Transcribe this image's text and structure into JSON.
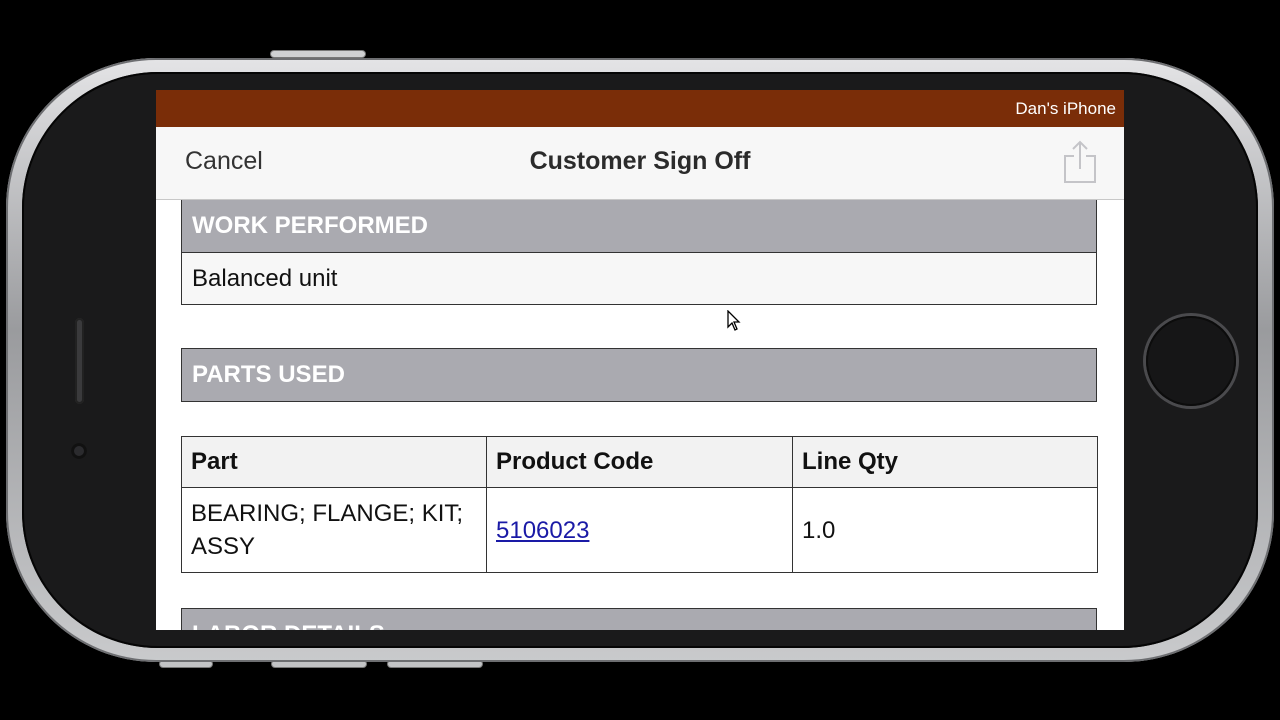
{
  "status_bar": {
    "device_name": "Dan's iPhone"
  },
  "nav": {
    "cancel_label": "Cancel",
    "title": "Customer Sign Off",
    "share_icon": "share-icon"
  },
  "work_performed": {
    "header": "WORK PERFORMED",
    "value": "Balanced unit"
  },
  "parts_used": {
    "header": "PARTS USED",
    "columns": [
      "Part",
      "Product Code",
      "Line Qty"
    ],
    "rows": [
      {
        "part": "BEARING; FLANGE; KIT; ASSY",
        "product_code": "5106023",
        "line_qty": "1.0"
      }
    ]
  },
  "labor_details": {
    "header": "LABOR DETAILS"
  },
  "colors": {
    "status_bar": "#7a2d08",
    "section_header": "#aaaab0",
    "link": "#1a1aa6"
  }
}
